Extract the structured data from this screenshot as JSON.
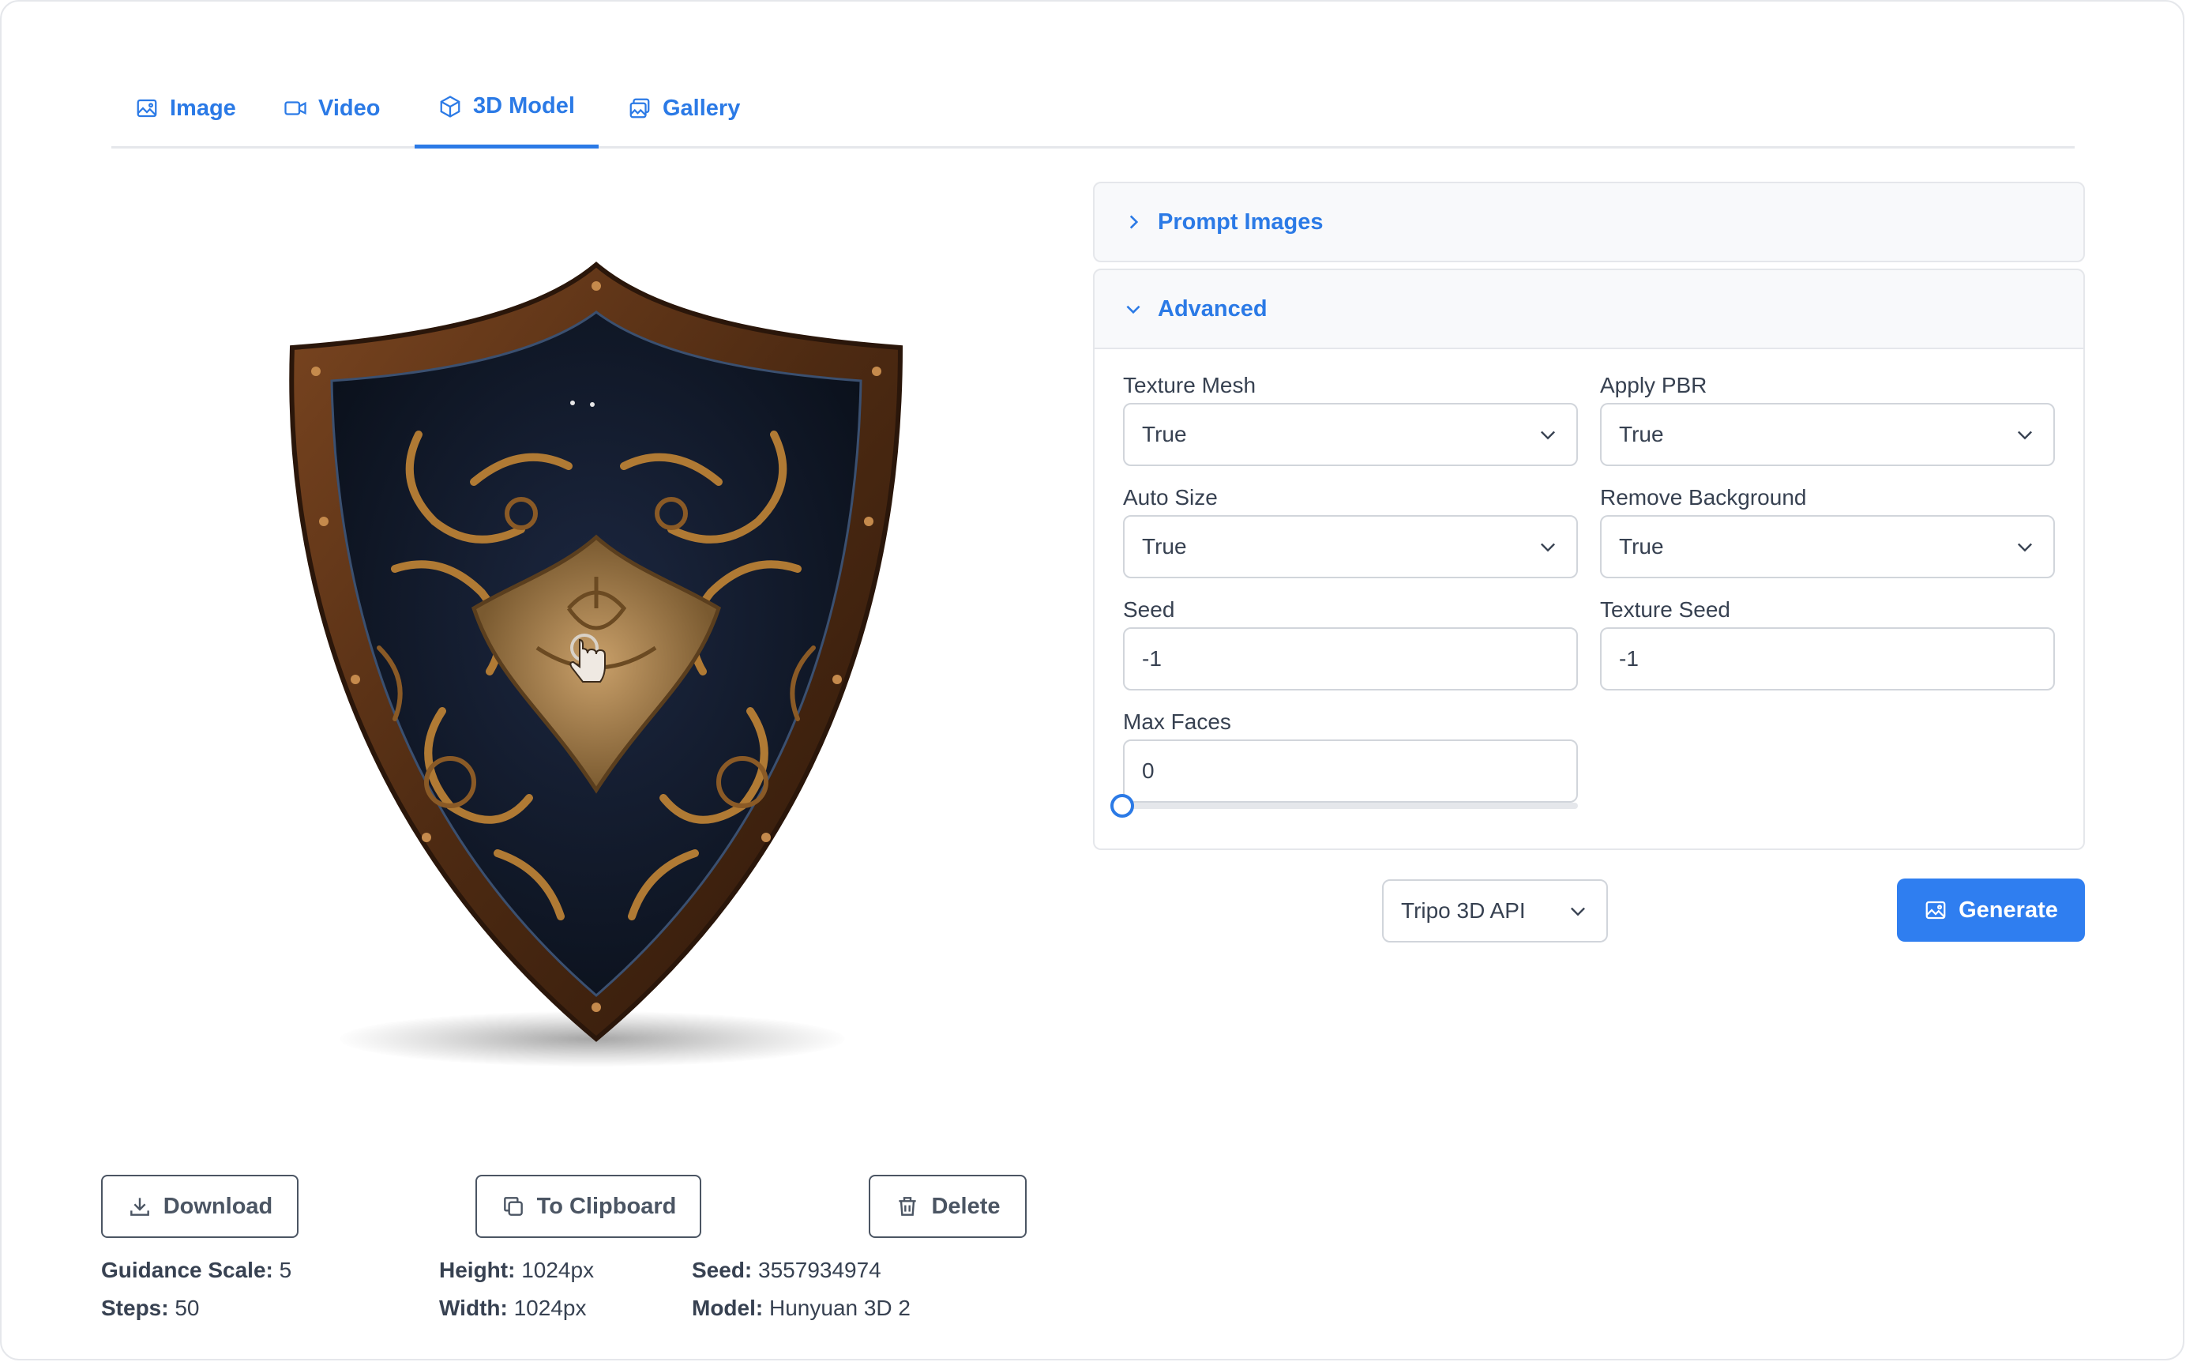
{
  "tabs": [
    {
      "label": "Image",
      "icon": "image-icon"
    },
    {
      "label": "Video",
      "icon": "video-icon"
    },
    {
      "label": "3D Model",
      "icon": "cube-icon",
      "active": true
    },
    {
      "label": "Gallery",
      "icon": "gallery-icon"
    }
  ],
  "panel": {
    "prompt_images_label": "Prompt Images",
    "advanced_label": "Advanced",
    "fields": {
      "texture_mesh": {
        "label": "Texture Mesh",
        "value": "True"
      },
      "apply_pbr": {
        "label": "Apply PBR",
        "value": "True"
      },
      "auto_size": {
        "label": "Auto Size",
        "value": "True"
      },
      "remove_background": {
        "label": "Remove Background",
        "value": "True"
      },
      "seed": {
        "label": "Seed",
        "value": "-1"
      },
      "texture_seed": {
        "label": "Texture Seed",
        "value": "-1"
      },
      "max_faces": {
        "label": "Max Faces",
        "value": "0",
        "slider_fraction": 0
      }
    },
    "provider": "Tripo 3D API",
    "generate_label": "Generate"
  },
  "actions": {
    "download": "Download",
    "clipboard": "To Clipboard",
    "delete": "Delete"
  },
  "meta": {
    "guidance_scale": {
      "label": "Guidance Scale:",
      "value": "5"
    },
    "steps": {
      "label": "Steps:",
      "value": "50"
    },
    "height": {
      "label": "Height:",
      "value": "1024px"
    },
    "width": {
      "label": "Width:",
      "value": "1024px"
    },
    "seed": {
      "label": "Seed:",
      "value": "3557934974"
    },
    "model": {
      "label": "Model:",
      "value": "Hunyuan 3D 2"
    }
  },
  "colors": {
    "accent": "#2b7ae6",
    "shield_wood": "#5a3318",
    "shield_face": "#121a2a",
    "ornament_gold": "#b07a34"
  }
}
